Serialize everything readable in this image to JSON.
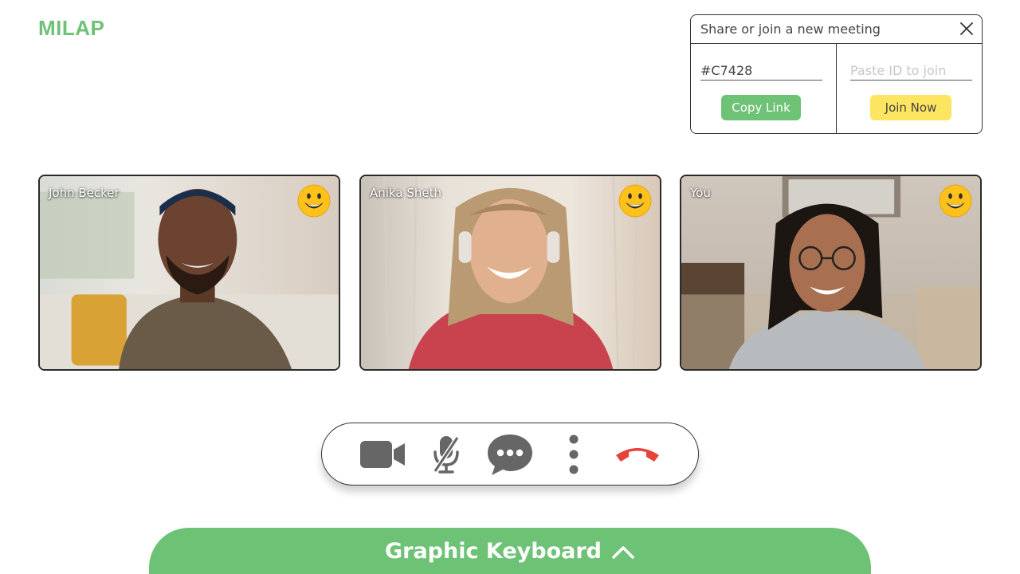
{
  "app": {
    "title": "MILAP"
  },
  "share_panel": {
    "title": "Share or join a new meeting",
    "meeting_id": "#C7428",
    "join_placeholder": "Paste ID to join",
    "copy_label": "Copy Link",
    "join_label": "Join Now"
  },
  "participants": [
    {
      "name": "John Becker",
      "reaction": "smiley-emoji-icon"
    },
    {
      "name": "Anika Sheth",
      "reaction": "smiley-emoji-icon"
    },
    {
      "name": "You",
      "reaction": "smiley-emoji-icon"
    }
  ],
  "controls": {
    "camera": "video-camera-icon",
    "mic": "mic-muted-icon",
    "chat": "chat-icon",
    "more": "more-vertical-icon",
    "end": "end-call-icon"
  },
  "keyboard": {
    "label": "Graphic Keyboard"
  },
  "colors": {
    "brand_green": "#6ec276",
    "join_yellow": "#fce560",
    "end_call_red": "#e8433a",
    "icon_gray": "#666666"
  }
}
